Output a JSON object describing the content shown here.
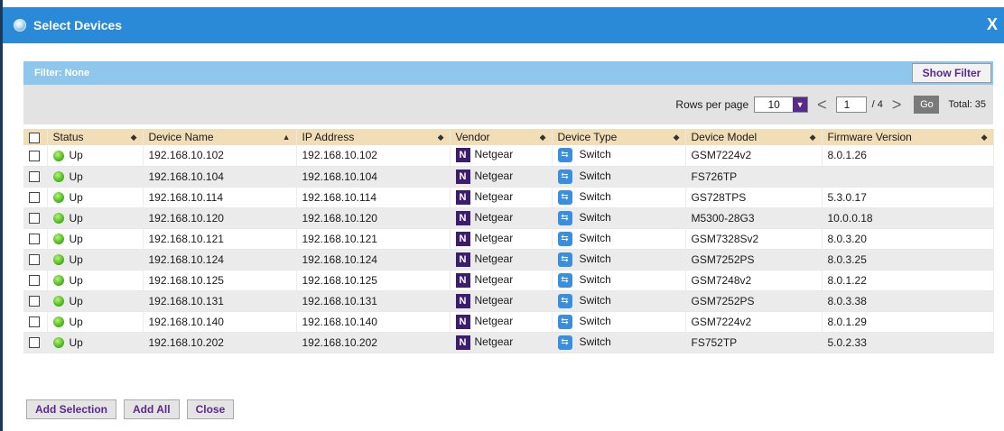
{
  "dialog": {
    "title": "Select Devices",
    "close_glyph": "X"
  },
  "filter": {
    "label": "Filter: None",
    "show_button": "Show Filter"
  },
  "pager": {
    "rows_label": "Rows per page",
    "rows_value": "10",
    "page_value": "1",
    "page_total": "/ 4",
    "go_label": "Go",
    "total_label": "Total: 35"
  },
  "columns": [
    {
      "label": "Status"
    },
    {
      "label": "Device Name"
    },
    {
      "label": "IP Address"
    },
    {
      "label": "Vendor"
    },
    {
      "label": "Device Type"
    },
    {
      "label": "Device Model"
    },
    {
      "label": "Firmware Version"
    }
  ],
  "sort_glyphs": {
    "both": "◆",
    "asc": "▲"
  },
  "rows": [
    {
      "status": "Up",
      "name": "192.168.10.102",
      "ip": "192.168.10.102",
      "vendor": "Netgear",
      "type": "Switch",
      "model": "GSM7224v2",
      "firmware": "8.0.1.26"
    },
    {
      "status": "Up",
      "name": "192.168.10.104",
      "ip": "192.168.10.104",
      "vendor": "Netgear",
      "type": "Switch",
      "model": "FS726TP",
      "firmware": ""
    },
    {
      "status": "Up",
      "name": "192.168.10.114",
      "ip": "192.168.10.114",
      "vendor": "Netgear",
      "type": "Switch",
      "model": "GS728TPS",
      "firmware": "5.3.0.17"
    },
    {
      "status": "Up",
      "name": "192.168.10.120",
      "ip": "192.168.10.120",
      "vendor": "Netgear",
      "type": "Switch",
      "model": "M5300-28G3",
      "firmware": "10.0.0.18"
    },
    {
      "status": "Up",
      "name": "192.168.10.121",
      "ip": "192.168.10.121",
      "vendor": "Netgear",
      "type": "Switch",
      "model": "GSM7328Sv2",
      "firmware": "8.0.3.20"
    },
    {
      "status": "Up",
      "name": "192.168.10.124",
      "ip": "192.168.10.124",
      "vendor": "Netgear",
      "type": "Switch",
      "model": "GSM7252PS",
      "firmware": "8.0.3.25"
    },
    {
      "status": "Up",
      "name": "192.168.10.125",
      "ip": "192.168.10.125",
      "vendor": "Netgear",
      "type": "Switch",
      "model": "GSM7248v2",
      "firmware": "8.0.1.22"
    },
    {
      "status": "Up",
      "name": "192.168.10.131",
      "ip": "192.168.10.131",
      "vendor": "Netgear",
      "type": "Switch",
      "model": "GSM7252PS",
      "firmware": "8.0.3.38"
    },
    {
      "status": "Up",
      "name": "192.168.10.140",
      "ip": "192.168.10.140",
      "vendor": "Netgear",
      "type": "Switch",
      "model": "GSM7224v2",
      "firmware": "8.0.1.29"
    },
    {
      "status": "Up",
      "name": "192.168.10.202",
      "ip": "192.168.10.202",
      "vendor": "Netgear",
      "type": "Switch",
      "model": "FS752TP",
      "firmware": "5.0.2.33"
    }
  ],
  "icons": {
    "vendor_glyph": "N",
    "type_glyph": "⇆"
  },
  "actions": {
    "add_selection": "Add Selection",
    "add_all": "Add All",
    "close": "Close"
  },
  "colors": {
    "titlebar": "#2a8ad8",
    "filterbar": "#8ec6ec",
    "header": "#f2deb6",
    "button_text": "#5a2a8a",
    "status_up": "#4cbc1e"
  }
}
